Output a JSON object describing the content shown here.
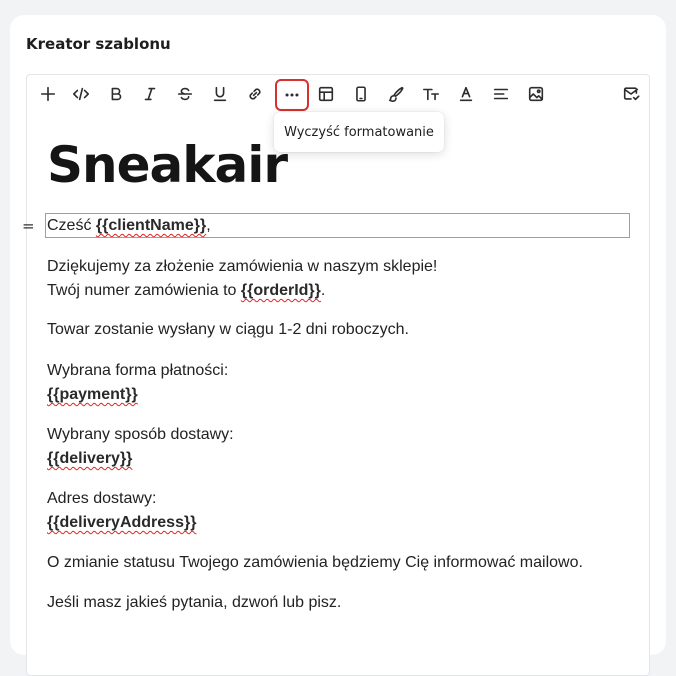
{
  "card": {
    "title": "Kreator szablonu"
  },
  "toolbar": {
    "buttons": [
      {
        "name": "add-icon",
        "label": "Dodaj"
      },
      {
        "name": "code-icon",
        "label": "Kod"
      },
      {
        "name": "bold-icon",
        "label": "B"
      },
      {
        "name": "italic-icon",
        "label": "I"
      },
      {
        "name": "strikethrough-icon",
        "label": "S"
      },
      {
        "name": "underline-icon",
        "label": "U"
      },
      {
        "name": "link-icon",
        "label": "Link"
      },
      {
        "name": "more-icon",
        "label": "Więcej"
      },
      {
        "name": "table-icon",
        "label": "Tabela"
      },
      {
        "name": "mobile-icon",
        "label": "Mobile"
      },
      {
        "name": "brush-icon",
        "label": "Pędzel"
      },
      {
        "name": "text-size-icon",
        "label": "Rozmiar"
      },
      {
        "name": "text-color-icon",
        "label": "Kolor"
      },
      {
        "name": "align-icon",
        "label": "Wyrównanie"
      },
      {
        "name": "image-icon",
        "label": "Obraz"
      },
      {
        "name": "email-preview-icon",
        "label": "Podgląd"
      }
    ],
    "active": "more-icon",
    "active_color": "#d93030"
  },
  "tooltip": {
    "text": "Wyczyść formatowanie"
  },
  "content": {
    "logo": "Sneakair",
    "greeting_prefix": "Cześć ",
    "greeting_var": "{{clientName}}",
    "greeting_suffix": ",",
    "thanks": "Dziękujemy za złożenie zamówienia w naszym sklepie!",
    "order_prefix": "Twój numer zamówienia to ",
    "order_var": "{{orderId}}",
    "order_suffix": ".",
    "shipping_info": "Towar zostanie wysłany w ciągu 1-2 dni roboczych.",
    "payment_label": "Wybrana forma płatności:",
    "payment_var": "{{payment}}",
    "delivery_label": "Wybrany sposób dostawy:",
    "delivery_var": "{{delivery}}",
    "address_label": "Adres dostawy:",
    "address_var": "{{deliveryAddress}}",
    "status_info": "O zmianie statusu Twojego zamówienia będziemy Cię informować mailowo.",
    "questions": "Jeśli masz jakieś pytania, dzwoń lub pisz."
  },
  "colors": {
    "selection_border": "#7aa6d8",
    "spellcheck_underline": "#e02424"
  }
}
